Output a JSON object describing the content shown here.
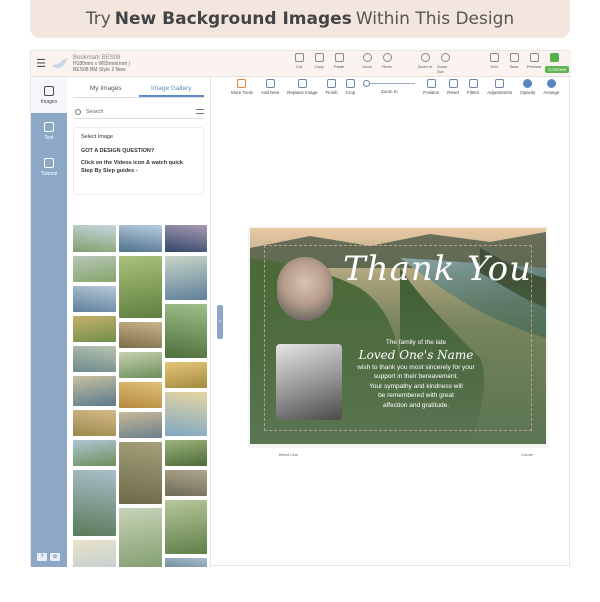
{
  "banner": {
    "pre": "Try",
    "bold": "New Background Images",
    "post": "Within This Design"
  },
  "colors": {
    "accent": "#5c8cc6",
    "rail": "#8da7c7",
    "continue": "#5db451",
    "banner_bg": "#f3e6df"
  },
  "document": {
    "name": "Bookmark BES08",
    "size": "H180mm x W55mm(mm )",
    "style": "BES08 BM Style 2 New"
  },
  "toolbar": [
    {
      "label": "Cut",
      "icon": "scissors-icon"
    },
    {
      "label": "Copy",
      "icon": "copy-icon"
    },
    {
      "label": "Paste",
      "icon": "paste-icon"
    },
    {
      "label": "Undo",
      "icon": "undo-icon"
    },
    {
      "label": "Redo",
      "icon": "redo-icon"
    },
    {
      "label": "Zoom In",
      "icon": "zoom-in-icon"
    },
    {
      "label": "Zoom Out",
      "icon": "zoom-out-icon"
    },
    {
      "label": "Grid",
      "icon": "grid-icon"
    },
    {
      "label": "Save",
      "icon": "save-icon"
    },
    {
      "label": "Preview",
      "icon": "preview-icon"
    }
  ],
  "continue_label": "Continue",
  "rail": [
    {
      "label": "Images",
      "icon": "image-icon"
    },
    {
      "label": "Text",
      "icon": "text-icon"
    },
    {
      "label": "Tutorial",
      "icon": "tutorial-icon"
    }
  ],
  "panel": {
    "tabs": [
      "My Images",
      "Image Gallery"
    ],
    "active_tab": "Image Gallery",
    "search_placeholder": "Search",
    "select_label": "Select Image",
    "question": "GOT A DESIGN QUESTION?",
    "help": "Click on the Videos icon & watch quick Step By Step guides -"
  },
  "canvas_tools": [
    {
      "label": "More Tools",
      "icon": "edit-icon"
    },
    {
      "label": "Add New",
      "icon": "add-image-icon"
    },
    {
      "label": "Replace Image",
      "icon": "replace-image-icon"
    },
    {
      "label": "Finish",
      "icon": "finish-icon"
    },
    {
      "label": "Crop",
      "icon": "crop-icon"
    },
    {
      "label": "Zoom In",
      "icon": "zoom-slider-icon"
    },
    {
      "label": "Position",
      "icon": "position-icon"
    },
    {
      "label": "Reset",
      "icon": "reset-icon"
    },
    {
      "label": "Filters",
      "icon": "filters-icon"
    },
    {
      "label": "Adjustments",
      "icon": "adjustments-icon"
    },
    {
      "label": "Opacity",
      "icon": "opacity-icon"
    },
    {
      "label": "Arrange",
      "icon": "arrange-icon"
    }
  ],
  "card": {
    "title": "Thank You",
    "line1": "The family of the late",
    "loved_one": "Loved One's Name",
    "line2": "wish to thank you most sincerely for your",
    "line3": "support in their bereavement.",
    "line4": "Your sympathy and kindness will",
    "line5": "be remembered with great",
    "line6": "affection and gratitude.",
    "label_left": "Bleed Line",
    "label_right": "Corner"
  }
}
